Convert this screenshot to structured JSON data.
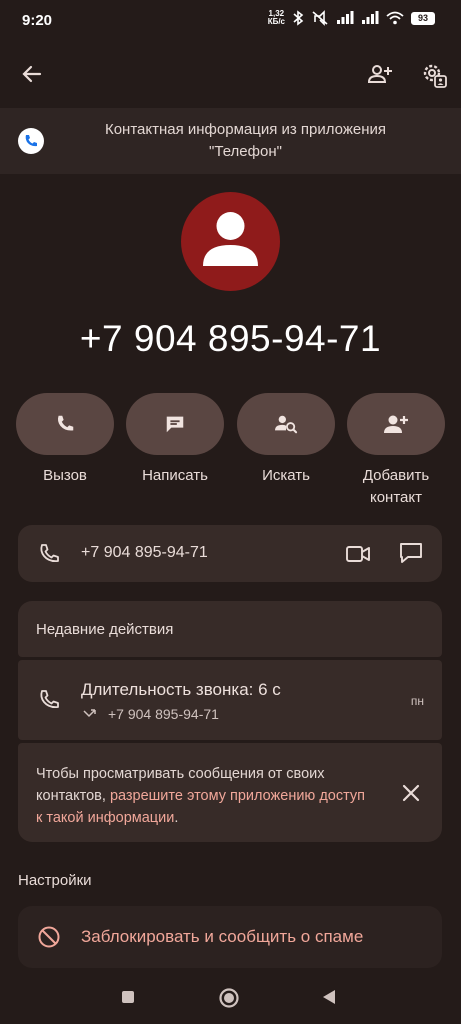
{
  "status_bar": {
    "time": "9:20",
    "net_speed": "1,32",
    "net_unit": "КБ/с",
    "battery": "93"
  },
  "banner": {
    "text_line1": "Контактная информация из приложения",
    "text_line2": "\"Телефон\""
  },
  "contact": {
    "phone": "+7 904 895-94-71"
  },
  "actions": [
    {
      "label": "Вызов",
      "icon": "phone-icon"
    },
    {
      "label": "Написать",
      "icon": "message-icon"
    },
    {
      "label": "Искать",
      "icon": "search-person-icon"
    },
    {
      "label": "Добавить контакт",
      "icon": "add-person-icon"
    }
  ],
  "phone_row": {
    "number": "+7 904 895-94-71"
  },
  "recent": {
    "title": "Недавние действия",
    "call_title": "Длительность звонка: 6 с",
    "call_number": "+7 904 895-94-71",
    "call_day": "пн",
    "msg_prefix": "Чтобы просматривать сообщения от своих контактов, ",
    "msg_link": "разрешите этому приложению доступ к такой информации",
    "msg_suffix": "."
  },
  "settings": {
    "title": "Настройки",
    "block_label": "Заблокировать и сообщить о спаме"
  },
  "colors": {
    "background": "#241b19",
    "card": "#372b28",
    "accent_link": "#f1a79a",
    "avatar": "#8f1b1b",
    "pill": "#5a4642"
  }
}
